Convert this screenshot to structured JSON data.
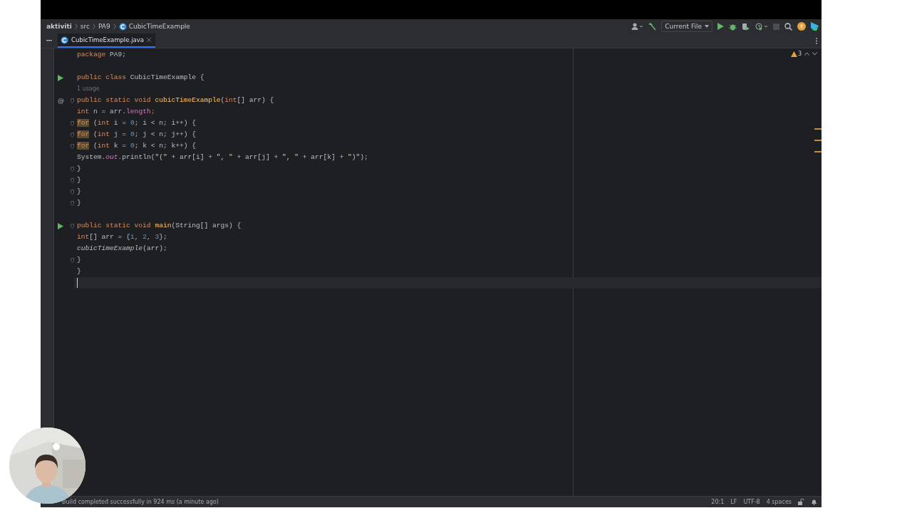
{
  "breadcrumbs": [
    {
      "label": "aktiviti",
      "kind": "project"
    },
    {
      "label": "src",
      "kind": "folder"
    },
    {
      "label": "PA9",
      "kind": "folder"
    },
    {
      "label": "CubicTimeExample",
      "kind": "class"
    }
  ],
  "toolbar": {
    "run_config": "Current File"
  },
  "tabs": [
    {
      "label": "CubicTimeExample.java",
      "selected": true
    }
  ],
  "inspections": {
    "warnings": "3"
  },
  "lines": [
    {
      "kind": "code",
      "tokens": [
        {
          "text": "package ",
          "kind": "kw"
        },
        {
          "text": "PA9;",
          "kind": "plain"
        }
      ]
    },
    {
      "kind": "blank"
    },
    {
      "kind": "code",
      "gutter": [
        {
          "kind": "run"
        }
      ],
      "tokens": [
        {
          "text": "public class ",
          "kind": "kw"
        },
        {
          "text": "CubicTimeExample {",
          "kind": "plain"
        }
      ]
    },
    {
      "kind": "hint",
      "text": "    1 usage"
    },
    {
      "kind": "code",
      "gutter": [
        {
          "kind": "text",
          "text": "@"
        },
        {
          "kind": "fold"
        }
      ],
      "tokens": [
        {
          "text": "    public static void ",
          "kind": "kw"
        },
        {
          "text": "cubicTimeExample",
          "kind": "decl"
        },
        {
          "text": "(",
          "kind": "plain"
        },
        {
          "text": "int",
          "kind": "kw"
        },
        {
          "text": "[] arr) {",
          "kind": "plain"
        }
      ]
    },
    {
      "kind": "code",
      "tokens": [
        {
          "text": "        int",
          "kind": "kw"
        },
        {
          "text": " n = arr.",
          "kind": "plain"
        },
        {
          "text": "length",
          "kind": "field"
        },
        {
          "text": ";",
          "kind": "kw"
        }
      ]
    },
    {
      "kind": "code",
      "gutter": [
        {
          "kind": "fold"
        }
      ],
      "tokens": [
        {
          "text": "        for",
          "kind": "loop"
        },
        {
          "text": " (",
          "kind": "plain"
        },
        {
          "text": "int",
          "kind": "kw"
        },
        {
          "text": " i = ",
          "kind": "plain"
        },
        {
          "text": "0",
          "kind": "num"
        },
        {
          "text": "; i < n; i++) {",
          "kind": "plain"
        }
      ]
    },
    {
      "kind": "code",
      "gutter": [
        {
          "kind": "fold"
        }
      ],
      "tokens": [
        {
          "text": "            for",
          "kind": "loop"
        },
        {
          "text": " (",
          "kind": "plain"
        },
        {
          "text": "int",
          "kind": "kw"
        },
        {
          "text": " j = ",
          "kind": "plain"
        },
        {
          "text": "0",
          "kind": "num"
        },
        {
          "text": "; j < n; j++) {",
          "kind": "plain"
        }
      ]
    },
    {
      "kind": "code",
      "gutter": [
        {
          "kind": "fold"
        }
      ],
      "tokens": [
        {
          "text": "                for",
          "kind": "loop"
        },
        {
          "text": " (",
          "kind": "plain"
        },
        {
          "text": "int",
          "kind": "kw"
        },
        {
          "text": " k = ",
          "kind": "plain"
        },
        {
          "text": "0",
          "kind": "num"
        },
        {
          "text": "; k < n; k++) {",
          "kind": "plain"
        }
      ]
    },
    {
      "kind": "code",
      "tokens": [
        {
          "text": "                    System.",
          "kind": "plain"
        },
        {
          "text": "out",
          "kind": "static"
        },
        {
          "text": ".println(",
          "kind": "plain"
        },
        {
          "text": "\"(\"",
          "kind": "str"
        },
        {
          "text": " + arr[i] + ",
          "kind": "plain"
        },
        {
          "text": "\", \"",
          "kind": "str"
        },
        {
          "text": " + arr[j] + ",
          "kind": "plain"
        },
        {
          "text": "\", \"",
          "kind": "str"
        },
        {
          "text": " + arr[k] + ",
          "kind": "plain"
        },
        {
          "text": "\")\"",
          "kind": "str"
        },
        {
          "text": ");",
          "kind": "plain"
        }
      ]
    },
    {
      "kind": "code",
      "gutter": [
        {
          "kind": "fold"
        }
      ],
      "tokens": [
        {
          "text": "                }",
          "kind": "plain"
        }
      ]
    },
    {
      "kind": "code",
      "gutter": [
        {
          "kind": "fold"
        }
      ],
      "tokens": [
        {
          "text": "            }",
          "kind": "plain"
        }
      ]
    },
    {
      "kind": "code",
      "gutter": [
        {
          "kind": "fold"
        }
      ],
      "tokens": [
        {
          "text": "        }",
          "kind": "plain"
        }
      ]
    },
    {
      "kind": "code",
      "gutter": [
        {
          "kind": "fold"
        }
      ],
      "tokens": [
        {
          "text": "    }",
          "kind": "plain"
        }
      ]
    },
    {
      "kind": "blank"
    },
    {
      "kind": "code",
      "gutter": [
        {
          "kind": "run"
        },
        {
          "kind": "fold"
        }
      ],
      "tokens": [
        {
          "text": "    public static void ",
          "kind": "kw"
        },
        {
          "text": "main",
          "kind": "decl"
        },
        {
          "text": "(String[] args) {",
          "kind": "plain"
        }
      ]
    },
    {
      "kind": "code",
      "tokens": [
        {
          "text": "        int",
          "kind": "kw"
        },
        {
          "text": "[] arr = {",
          "kind": "plain"
        },
        {
          "text": "1",
          "kind": "num"
        },
        {
          "text": ", ",
          "kind": "kw"
        },
        {
          "text": "2",
          "kind": "num"
        },
        {
          "text": ", ",
          "kind": "kw"
        },
        {
          "text": "3",
          "kind": "num"
        },
        {
          "text": "};",
          "kind": "plain"
        }
      ]
    },
    {
      "kind": "code",
      "tokens": [
        {
          "text": "        cubicTimeExample",
          "kind": "call"
        },
        {
          "text": "(arr);",
          "kind": "plain"
        }
      ]
    },
    {
      "kind": "code",
      "gutter": [
        {
          "kind": "fold"
        }
      ],
      "tokens": [
        {
          "text": "    }",
          "kind": "plain"
        }
      ]
    },
    {
      "kind": "code",
      "tokens": [
        {
          "text": "}",
          "kind": "plain"
        }
      ]
    },
    {
      "kind": "cursor"
    }
  ],
  "status_bar": {
    "message": "Build completed successfully in 924 ms (a minute ago)",
    "items": [
      "20:1",
      "LF",
      "UTF-8",
      "4 spaces"
    ]
  }
}
